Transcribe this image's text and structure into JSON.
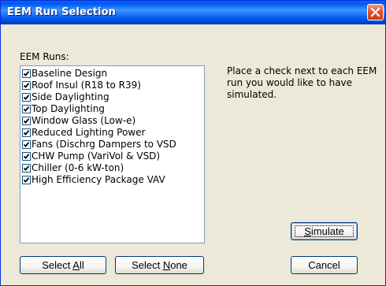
{
  "window": {
    "title": "EEM Run Selection"
  },
  "runs_label": "EEM Runs:",
  "runs": [
    {
      "label": "Baseline Design",
      "checked": true
    },
    {
      "label": "Roof Insul (R18 to R39)",
      "checked": true
    },
    {
      "label": "Side Daylighting",
      "checked": true
    },
    {
      "label": "Top Daylighting",
      "checked": true
    },
    {
      "label": "Window Glass (Low-e)",
      "checked": true
    },
    {
      "label": "Reduced Lighting Power",
      "checked": true
    },
    {
      "label": "Fans (Dischrg Dampers to VSD",
      "checked": true
    },
    {
      "label": "CHW Pump (VariVol & VSD)",
      "checked": true
    },
    {
      "label": "Chiller (0-6 kW-ton)",
      "checked": true
    },
    {
      "label": "High Efficiency Package VAV",
      "checked": true
    }
  ],
  "instructions": "Place a check next to each EEM run you would like to have simulated.",
  "buttons": {
    "simulate": "Simulate",
    "select_all": "Select All",
    "select_none": "Select None",
    "cancel": "Cancel"
  },
  "colors": {
    "title_bar": "#0058ee",
    "dialog_bg": "#ece9d8",
    "close_button": "#e2532e"
  }
}
